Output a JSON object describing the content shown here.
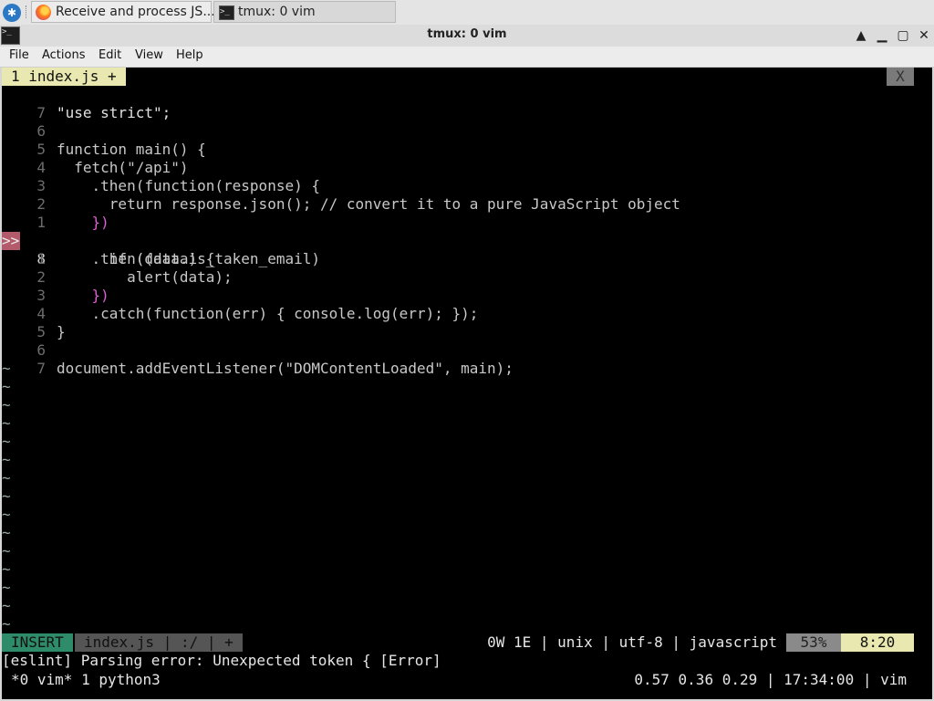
{
  "taskbar": {
    "tasks": [
      {
        "label": "Receive and process JS...",
        "icon": "firefox-icon"
      },
      {
        "label": "tmux: 0 vim",
        "icon": "terminal-icon"
      }
    ]
  },
  "window": {
    "title": "tmux: 0 vim",
    "controls": [
      "▲",
      "▁",
      "▢",
      "✕"
    ]
  },
  "menubar": [
    "File",
    "Actions",
    "Edit",
    "View",
    "Help"
  ],
  "vim": {
    "tab_label": "1 index.js +",
    "tab_close": "X",
    "sign_text": ">>",
    "lines": [
      {
        "num": "7",
        "code": "\"use strict\";"
      },
      {
        "num": "6",
        "code": ""
      },
      {
        "num": "5",
        "code": "function main() {"
      },
      {
        "num": "4",
        "code": "  fetch(\"/api\")"
      },
      {
        "num": "3",
        "code": "    .then(function(response) {"
      },
      {
        "num": "2",
        "code": "      return response.json(); // convert it to a pure JavaScript object"
      },
      {
        "num": "1",
        "code": "    })"
      },
      {
        "num": "8",
        "code": "    .then((data) {"
      },
      {
        "num": "1",
        "code": "      if (data.is_taken_email)"
      },
      {
        "num": "2",
        "code": "        alert(data);"
      },
      {
        "num": "3",
        "code": "    })"
      },
      {
        "num": "4",
        "code": "    .catch(function(err) { console.log(err); });"
      },
      {
        "num": "5",
        "code": "}"
      },
      {
        "num": "6",
        "code": ""
      },
      {
        "num": "7",
        "code": "document.addEventListener(\"DOMContentLoaded\", main);"
      }
    ],
    "status": {
      "mode": "INSERT",
      "file": "index.js | :/ | +",
      "info": "0W 1E | unix | utf-8 | javascript",
      "percent": "53%",
      "position": "8:20"
    },
    "message": "[eslint] Parsing error: Unexpected token { [Error]"
  },
  "tmux": {
    "left": "*0 vim* 1 python3",
    "right": "0.57 0.36 0.29 | 17:34:00 | vim"
  }
}
